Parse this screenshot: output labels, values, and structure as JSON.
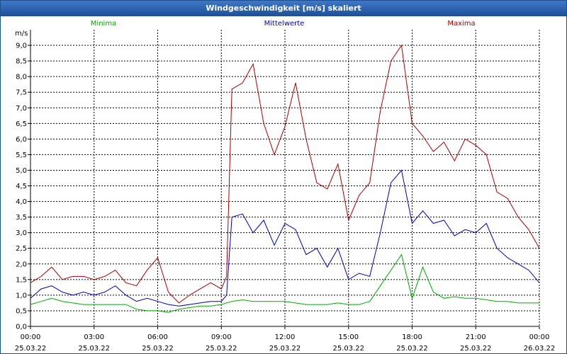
{
  "window": {
    "title": "Windgeschwindigkeit [m/s] skaliert"
  },
  "chart_data": {
    "type": "line",
    "title": "Windgeschwindigkeit [m/s] skaliert",
    "ylabel": "m/s",
    "ylim": [
      0,
      9.5
    ],
    "grid": true,
    "legend_placement": "top",
    "y_ticks": [
      "0,0",
      "0,5",
      "1,0",
      "1,5",
      "2,0",
      "2,5",
      "3,0",
      "3,5",
      "4,0",
      "4,5",
      "5,0",
      "5,5",
      "6,0",
      "6,5",
      "7,0",
      "7,5",
      "8,0",
      "8,5",
      "9,0"
    ],
    "x_ticks": [
      {
        "time": "00:00",
        "date": "25.03.22"
      },
      {
        "time": "03:00",
        "date": "25.03.22"
      },
      {
        "time": "06:00",
        "date": "25.03.22"
      },
      {
        "time": "09:00",
        "date": "25.03.22"
      },
      {
        "time": "12:00",
        "date": "25.03.22"
      },
      {
        "time": "15:00",
        "date": "25.03.22"
      },
      {
        "time": "18:00",
        "date": "25.03.22"
      },
      {
        "time": "21:00",
        "date": "25.03.22"
      },
      {
        "time": "00:00",
        "date": "26.03.22"
      }
    ],
    "x_hours": [
      0,
      0.5,
      1,
      1.5,
      2,
      2.5,
      3,
      3.5,
      4,
      4.5,
      5,
      5.5,
      6,
      6.5,
      7,
      7.5,
      8,
      8.5,
      9,
      9.25,
      9.5,
      10,
      10.5,
      11,
      11.5,
      12,
      12.5,
      13,
      13.5,
      14,
      14.5,
      15,
      15.5,
      16,
      16.5,
      17,
      17.5,
      18,
      18.5,
      19,
      19.5,
      20,
      20.5,
      21,
      21.5,
      22,
      22.5,
      23,
      23.5,
      24
    ],
    "series": [
      {
        "name": "Minima",
        "color": "#00aa00",
        "values": [
          0.7,
          0.8,
          0.9,
          0.8,
          0.75,
          0.7,
          0.7,
          0.7,
          0.7,
          0.7,
          0.55,
          0.5,
          0.5,
          0.45,
          0.55,
          0.6,
          0.65,
          0.65,
          0.7,
          0.75,
          0.8,
          0.85,
          0.8,
          0.8,
          0.8,
          0.8,
          0.75,
          0.7,
          0.7,
          0.7,
          0.75,
          0.7,
          0.7,
          0.8,
          1.3,
          1.8,
          2.3,
          0.9,
          1.9,
          1.1,
          0.9,
          0.95,
          0.9,
          0.9,
          0.85,
          0.8,
          0.8,
          0.75,
          0.75,
          0.75
        ]
      },
      {
        "name": "Mittelwerte",
        "color": "#0000bb",
        "values": [
          0.9,
          1.2,
          1.3,
          1.1,
          1.0,
          1.1,
          1.0,
          1.1,
          1.3,
          1.0,
          0.8,
          0.9,
          0.8,
          0.7,
          0.65,
          0.7,
          0.75,
          0.8,
          0.8,
          1.0,
          3.5,
          3.6,
          3.0,
          3.4,
          2.6,
          3.3,
          3.1,
          2.3,
          2.5,
          1.9,
          2.5,
          1.5,
          1.7,
          1.6,
          3.0,
          4.6,
          5.0,
          3.3,
          3.7,
          3.3,
          3.4,
          2.9,
          3.1,
          3.0,
          3.3,
          2.5,
          2.2,
          2.0,
          1.8,
          1.4
        ]
      },
      {
        "name": "Maxima",
        "color": "#aa0000",
        "values": [
          1.4,
          1.6,
          1.9,
          1.5,
          1.6,
          1.6,
          1.5,
          1.6,
          1.8,
          1.4,
          1.3,
          1.8,
          2.2,
          1.1,
          0.75,
          1.0,
          1.2,
          1.4,
          1.2,
          1.6,
          7.6,
          7.8,
          8.4,
          6.5,
          5.5,
          6.4,
          7.8,
          6.0,
          4.6,
          4.4,
          5.2,
          3.4,
          4.2,
          4.6,
          6.9,
          8.5,
          9.0,
          6.5,
          6.1,
          5.6,
          5.9,
          5.3,
          6.0,
          5.8,
          5.5,
          4.3,
          4.1,
          3.5,
          3.1,
          2.5
        ]
      }
    ]
  }
}
